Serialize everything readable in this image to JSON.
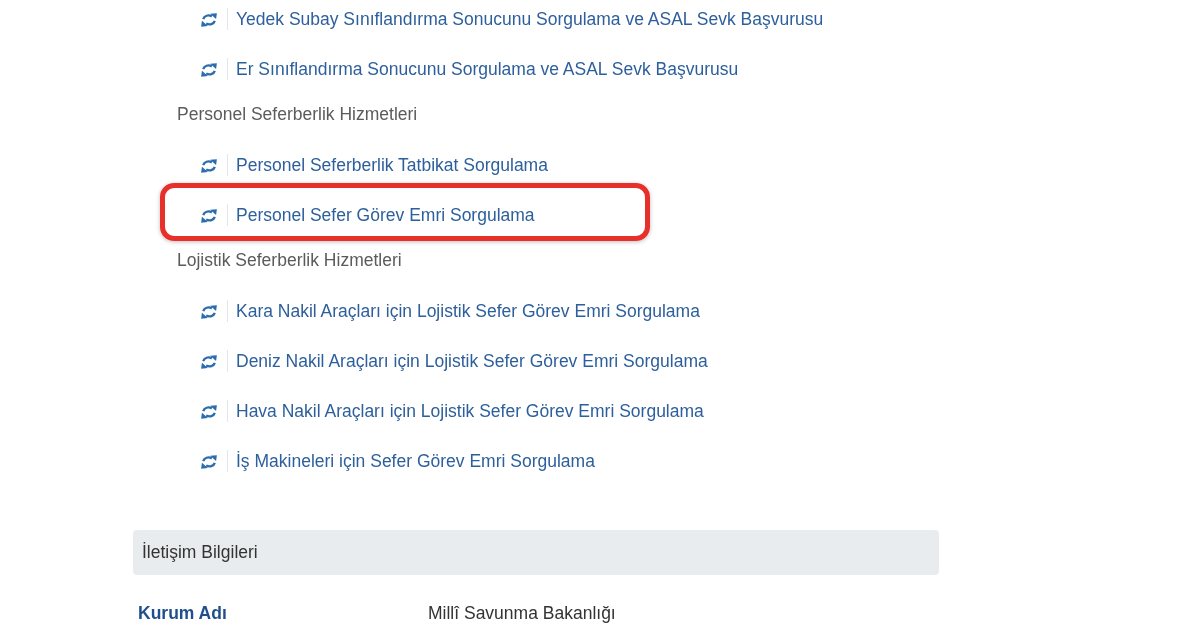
{
  "groups": [
    {
      "items": [
        {
          "label": "Yedek Subay Sınıflandırma Sonucunu Sorgulama ve ASAL Sevk Başvurusu",
          "highlighted": false
        },
        {
          "label": "Er Sınıflandırma Sonucunu Sorgulama ve ASAL Sevk Başvurusu",
          "highlighted": false
        }
      ]
    },
    {
      "title": "Personel Seferberlik Hizmetleri",
      "items": [
        {
          "label": "Personel Seferberlik Tatbikat Sorgulama",
          "highlighted": false
        },
        {
          "label": "Personel Sefer Görev Emri Sorgulama",
          "highlighted": true
        }
      ]
    },
    {
      "title": "Lojistik Seferberlik Hizmetleri",
      "items": [
        {
          "label": "Kara Nakil Araçları için Lojistik Sefer Görev Emri Sorgulama",
          "highlighted": false
        },
        {
          "label": "Deniz Nakil Araçları için Lojistik Sefer Görev Emri Sorgulama",
          "highlighted": false
        },
        {
          "label": "Hava Nakil Araçları için Lojistik Sefer Görev Emri Sorgulama",
          "highlighted": false
        },
        {
          "label": "İş Makineleri için Sefer Görev Emri Sorgulama",
          "highlighted": false
        }
      ]
    }
  ],
  "contact_section": {
    "title": "İletişim Bilgileri",
    "fields": [
      {
        "label": "Kurum Adı",
        "value": "Millî Savunma Bakanlığı"
      }
    ]
  }
}
